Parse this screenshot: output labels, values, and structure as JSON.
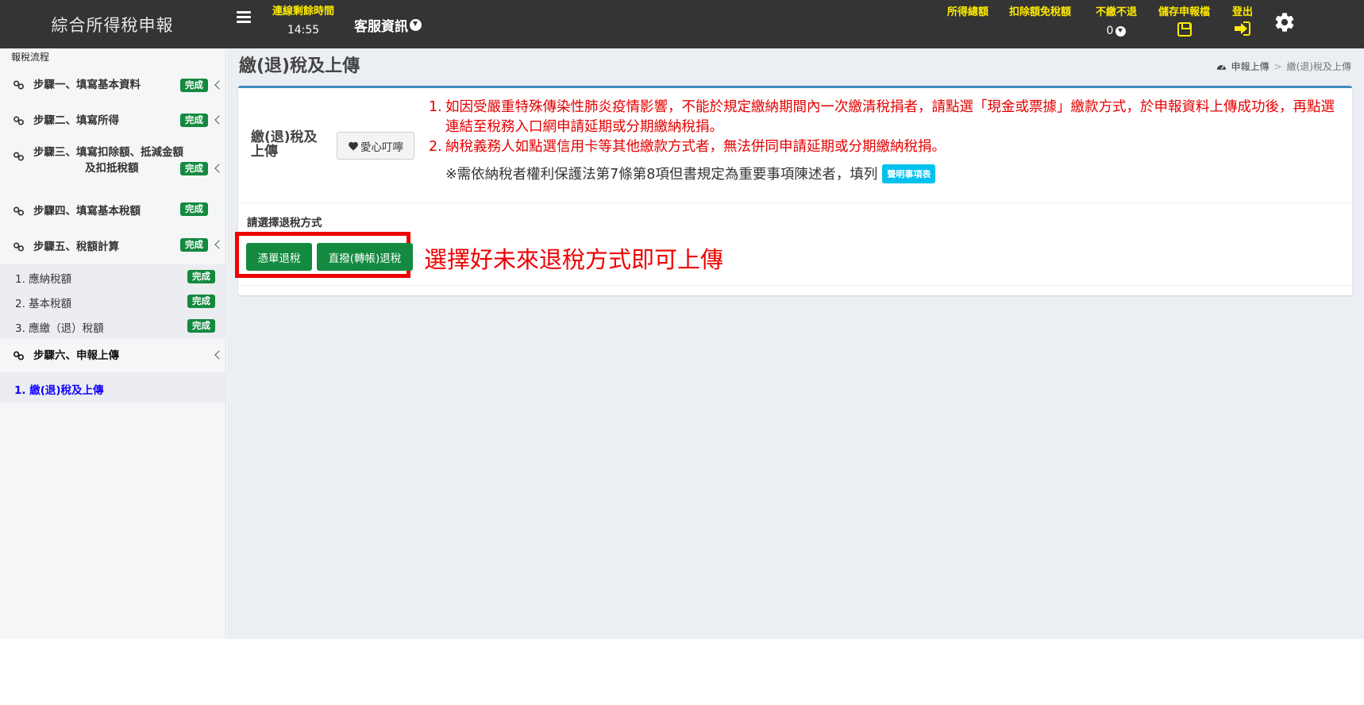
{
  "header": {
    "brand": "綜合所得稅申報",
    "timer_label": "連線剩餘時間",
    "timer_value": "14:55",
    "service_info": "客服資訊",
    "nav": {
      "income_total": "所得總額",
      "deduction_exemption": "扣除額免稅額",
      "no_pay_no_refund": "不繳不退",
      "no_pay_value": "0",
      "save_file": "儲存申報檔",
      "logout": "登出"
    }
  },
  "sidebar": {
    "title": "報稅流程",
    "badge_done": "完成",
    "steps": [
      {
        "label": "步驟一、填寫基本資料"
      },
      {
        "label": "步驟二、填寫所得"
      },
      {
        "label_line1": "步驟三、填寫扣除額、抵減金額",
        "label_line2": "及扣抵稅額"
      },
      {
        "label": "步驟四、填寫基本稅額"
      },
      {
        "label": "步驟五、稅額計算"
      }
    ],
    "substeps": [
      {
        "label": "1. 應納稅額"
      },
      {
        "label": "2. 基本稅額"
      },
      {
        "label": "3. 應繳（退）稅額"
      }
    ],
    "step6": "步驟六、申報上傳",
    "active_sub": "1. 繳(退)稅及上傳"
  },
  "main": {
    "title": "繳(退)稅及上傳",
    "breadcrumb": {
      "root": "申報上傳",
      "separator": ">",
      "current": "繳(退)稅及上傳"
    },
    "card_title": "繳(退)稅及上傳",
    "care_button": "愛心叮嚀",
    "notes": [
      {
        "num": "1.",
        "text": "如因受嚴重特殊傳染性肺炎疫情影響，不能於規定繳納期間內一次繳清稅捐者，請點選「現金或票據」繳款方式，於申報資料上傳成功後，再點選連結至稅務入口網申請延期或分期繳納稅捐。"
      },
      {
        "num": "2.",
        "text": "納稅義務人如點選信用卡等其他繳款方式者，無法併同申請延期或分期繳納稅捐。"
      }
    ],
    "declaration_text": "※需依納稅者權利保護法第7條第8項但書規定為重要事項陳述者，填列",
    "declaration_button": "聲明事項表",
    "refund_method_label": "請選擇退稅方式",
    "refund_buttons": {
      "voucher": "憑單退稅",
      "transfer": "直撥(轉帳)退稅"
    },
    "hint": "選擇好未來退稅方式即可上傳"
  },
  "colors": {
    "header_bg": "#343434",
    "header_accent": "#ffeb00",
    "badge_green": "#138a3f",
    "card_border": "#3c8dbc",
    "note_red": "#e60000",
    "active_blue": "#1100ff",
    "declaration_cyan": "#00c0ef"
  }
}
